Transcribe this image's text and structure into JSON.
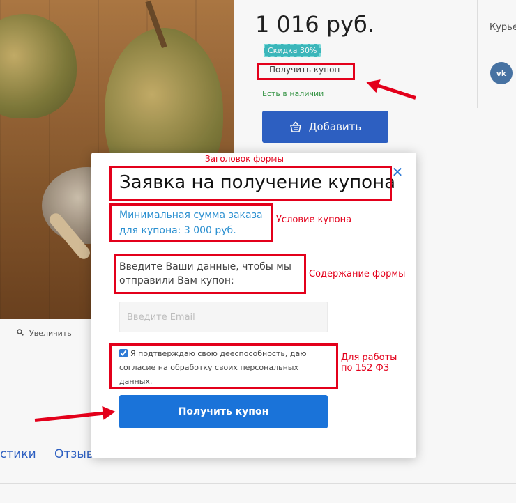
{
  "product": {
    "price": "1 016 руб.",
    "discount_badge": "Скидка 30%",
    "coupon_link": "Получить купон",
    "availability": "Есть в наличии",
    "add_button": "Добавить",
    "zoom_label": "Увеличить"
  },
  "side": {
    "delivery_partial": "Курье",
    "vk_label": "vk"
  },
  "tabs": {
    "characteristics_partial": "стики",
    "reviews_partial": "Отзыв"
  },
  "modal": {
    "title": "Заявка на получение купона",
    "condition": "Минимальная сумма заказа для купона: 3 000 руб.",
    "description": "Введите Ваши данные, чтобы мы отправили Вам купон:",
    "email_placeholder": "Введите Email",
    "consent_text": "Я подтверждаю свою дееспособность, даю согласие на обработку своих персональных данных.",
    "consent_checked": true,
    "submit_label": "Получить купон",
    "close_symbol": "✕"
  },
  "annotations": {
    "title_label": "Заголовок формы",
    "condition_label": "Условие купона",
    "content_label": "Содержание формы",
    "law_label_line1": "Для работы",
    "law_label_line2": "по 152 ФЗ"
  },
  "colors": {
    "annotation": "#e3001b",
    "primary_button": "#1a73d9",
    "add_button": "#2f63c8",
    "discount": "#3dbcc0",
    "condition_text": "#2a8fd0"
  }
}
